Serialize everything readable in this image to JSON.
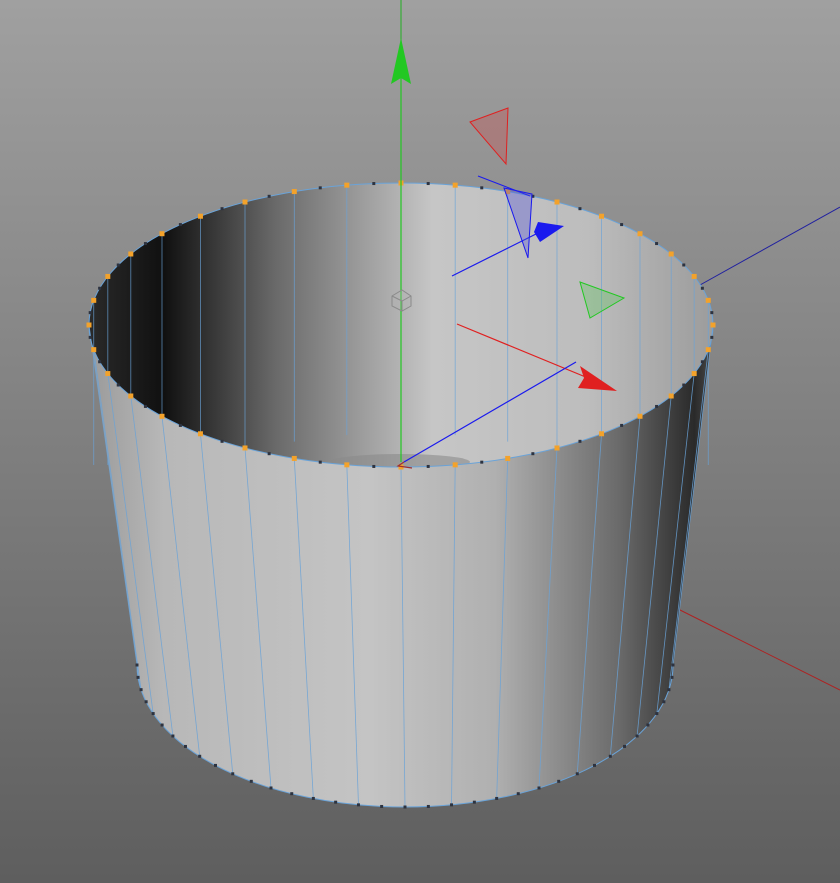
{
  "viewport": {
    "background_top": "#a0a0a0",
    "background_bottom": "#5e5e5e"
  },
  "object": {
    "type": "open-cylinder",
    "segments": 36,
    "surface_color": "#b4b4b4",
    "edge_color": "#6aa3d8",
    "point_color": "#f3a22b",
    "point_dark_color": "#2d3340",
    "selected": true
  },
  "gizmo": {
    "x_axis_color": "#e02020",
    "y_axis_color": "#22c822",
    "z_axis_color": "#1a1aee",
    "handles": [
      "x-axis-handle",
      "y-axis-handle",
      "z-axis-handle"
    ],
    "plane_handles": [
      "xy-plane-handle",
      "yz-plane-handle",
      "xz-plane-handle"
    ]
  },
  "world_axis": {
    "x_color": "#b02020",
    "z_color": "#2020a0",
    "y_color": "#22b022"
  }
}
